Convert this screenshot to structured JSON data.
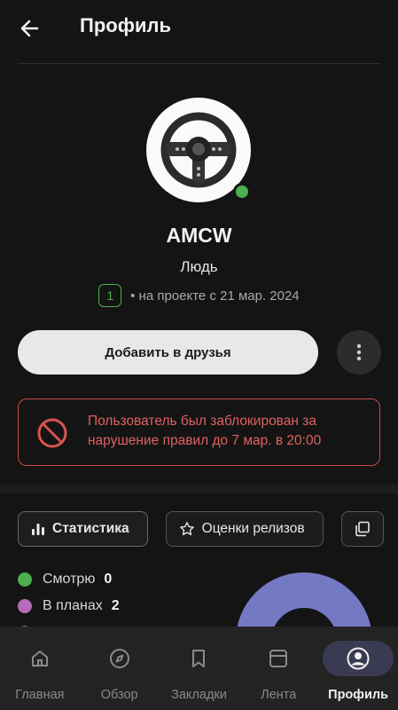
{
  "header": {
    "title": "Профиль"
  },
  "profile": {
    "username": "AMCW",
    "status": "Людь",
    "level": "1",
    "since": "• на проекте с 21 мар. 2024"
  },
  "actions": {
    "add_friend": "Добавить в друзья"
  },
  "ban_notice": {
    "text": "Пользователь был заблокирован за нарушение правил до 7 мар. в 20:00"
  },
  "tabs": [
    {
      "label": "Статистика",
      "icon": "bar-chart-icon",
      "active": true
    },
    {
      "label": "Оценки релизов",
      "icon": "star-icon",
      "active": false
    }
  ],
  "stats": [
    {
      "label": "Смотрю",
      "value": "0",
      "color": "#4caf50"
    },
    {
      "label": "В планах",
      "value": "2",
      "color": "#b56bb8"
    },
    {
      "label": "",
      "value": "",
      "color": "#7479c4"
    }
  ],
  "colors": {
    "accent_online": "#4caf50",
    "ban_red": "#d9534f",
    "donut": "#7479c4",
    "active_nav": "#3a3a52"
  },
  "nav": [
    {
      "label": "Главная",
      "icon": "home-icon",
      "active": false
    },
    {
      "label": "Обзор",
      "icon": "compass-icon",
      "active": false
    },
    {
      "label": "Закладки",
      "icon": "bookmark-icon",
      "active": false
    },
    {
      "label": "Лента",
      "icon": "feed-icon",
      "active": false
    },
    {
      "label": "Профиль",
      "icon": "profile-icon",
      "active": true
    }
  ]
}
